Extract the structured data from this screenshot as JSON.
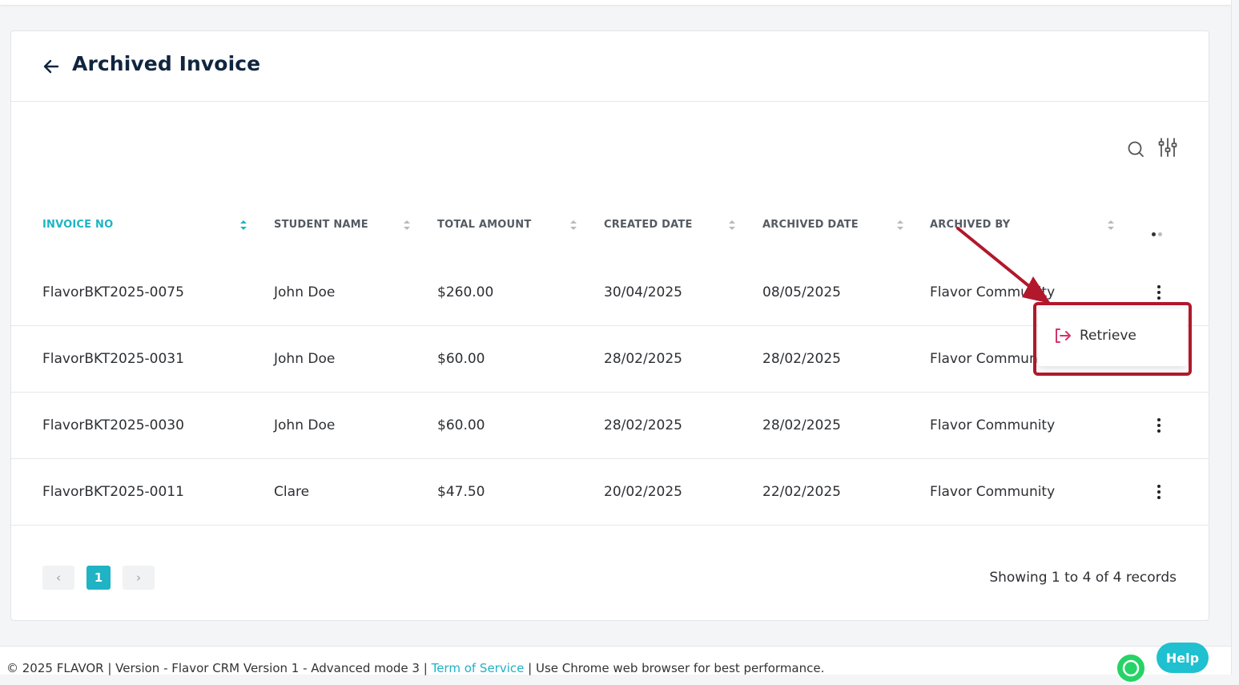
{
  "page": {
    "title": "Archived Invoice"
  },
  "table": {
    "columns": [
      {
        "label": "INVOICE NO"
      },
      {
        "label": "STUDENT NAME"
      },
      {
        "label": "TOTAL AMOUNT"
      },
      {
        "label": "CREATED DATE"
      },
      {
        "label": "ARCHIVED DATE"
      },
      {
        "label": "ARCHIVED BY"
      }
    ],
    "rows": [
      {
        "invoice_no": "FlavorBKT2025-0075",
        "student": "John Doe",
        "amount": "$260.00",
        "created": "30/04/2025",
        "archived": "08/05/2025",
        "by": "Flavor Community"
      },
      {
        "invoice_no": "FlavorBKT2025-0031",
        "student": "John Doe",
        "amount": "$60.00",
        "created": "28/02/2025",
        "archived": "28/02/2025",
        "by": "Flavor Community"
      },
      {
        "invoice_no": "FlavorBKT2025-0030",
        "student": "John Doe",
        "amount": "$60.00",
        "created": "28/02/2025",
        "archived": "28/02/2025",
        "by": "Flavor Community"
      },
      {
        "invoice_no": "FlavorBKT2025-0011",
        "student": "Clare",
        "amount": "$47.50",
        "created": "20/02/2025",
        "archived": "22/02/2025",
        "by": "Flavor Community"
      }
    ]
  },
  "row_menu": {
    "retrieve_label": "Retrieve"
  },
  "pagination": {
    "current_page": "1",
    "prev_glyph": "‹",
    "next_glyph": "›",
    "records_text": "Showing 1 to 4 of 4 records"
  },
  "footer": {
    "prefix": "© 2025 FLAVOR | Version - Flavor CRM Version 1 - Advanced mode 3 | ",
    "link": "Term of Service",
    "suffix": " | Use Chrome web browser for best performance."
  },
  "help_label": "Help",
  "icons": {
    "back": "arrow-left-icon",
    "search": "search-icon",
    "filter": "sliders-icon",
    "row_actions": "kebab-icon",
    "retrieve": "sign-in-icon",
    "chat": "whatsapp-icon"
  },
  "colors": {
    "accent": "#1fb3c4",
    "title": "#10253f",
    "annotation": "#b1182c",
    "retrieve_icon": "#d6336c"
  }
}
